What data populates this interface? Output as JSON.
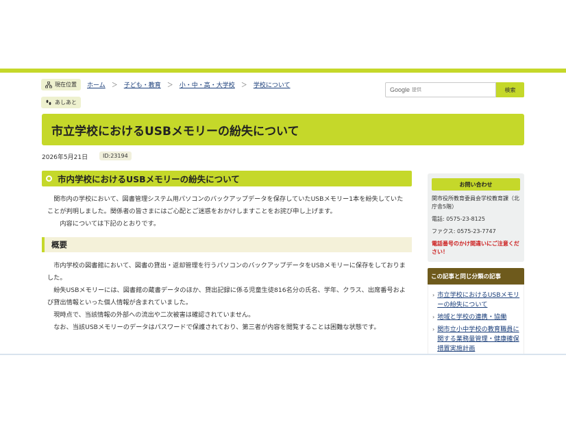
{
  "breadcrumb": {
    "label": "現在位置",
    "items": [
      "ホーム",
      "子ども・教育",
      "小・中・高・大学校",
      "学校について"
    ],
    "separator": "＞"
  },
  "ashiato": "あしあと",
  "search": {
    "brand": "Google",
    "sub": "提供",
    "button": "検索"
  },
  "page_title": "市立学校におけるUSBメモリーの紛失について",
  "date": "2026年5月21日",
  "id_badge": "ID:23194",
  "main": {
    "heading": "市内学校におけるUSBメモリーの紛失について",
    "para1": "関市内の学校において、図書管理システム用パソコンのバックアップデータを保存していたUSBメモリー1本を紛失していたことが判明しました。関係者の皆さまにはご心配とご迷惑をおかけしますことをお詫び申し上げます。",
    "para2": "内容については下記のとおりです。",
    "section": "概要",
    "lines": [
      "市内学校の図書館において、図書の貸出・返却管理を行うパソコンのバックアップデータをUSBメモリーに保存をしておりました。",
      "紛失USBメモリーには、図書館の蔵書データのほか、貸出記録に係る児童生徒816名分の氏名、学年、クラス、出席番号および貸出情報といった個人情報が含まれていました。",
      "現時点で、当該情報の外部への流出や二次被害は確認されていません。",
      "なお、当該USBメモリーのデータはパスワードで保護されており、第三者が内容を閲覧することは困難な状態です。"
    ]
  },
  "contact": {
    "title": "お問い合わせ",
    "dept": "関市役所教育委員会学校教育課（北庁舎5階）",
    "tel": "電話: 0575-23-8125",
    "fax": "ファクス: 0575-23-7747",
    "warning": "電話番号のかけ間違いにご注意ください！"
  },
  "related": {
    "title": "この記事と同じ分類の記事",
    "items": [
      "市立学校におけるUSBメモリーの紛失について",
      "地域と学校の連携・協働",
      "関市立小中学校の教育職員に関する業務量管理・健康確保措置実施計画"
    ]
  },
  "colors": {
    "accent": "#c5d82a",
    "link": "#1a3e7a",
    "warning": "#cc1c1c",
    "related_header": "#6e5a1c"
  }
}
